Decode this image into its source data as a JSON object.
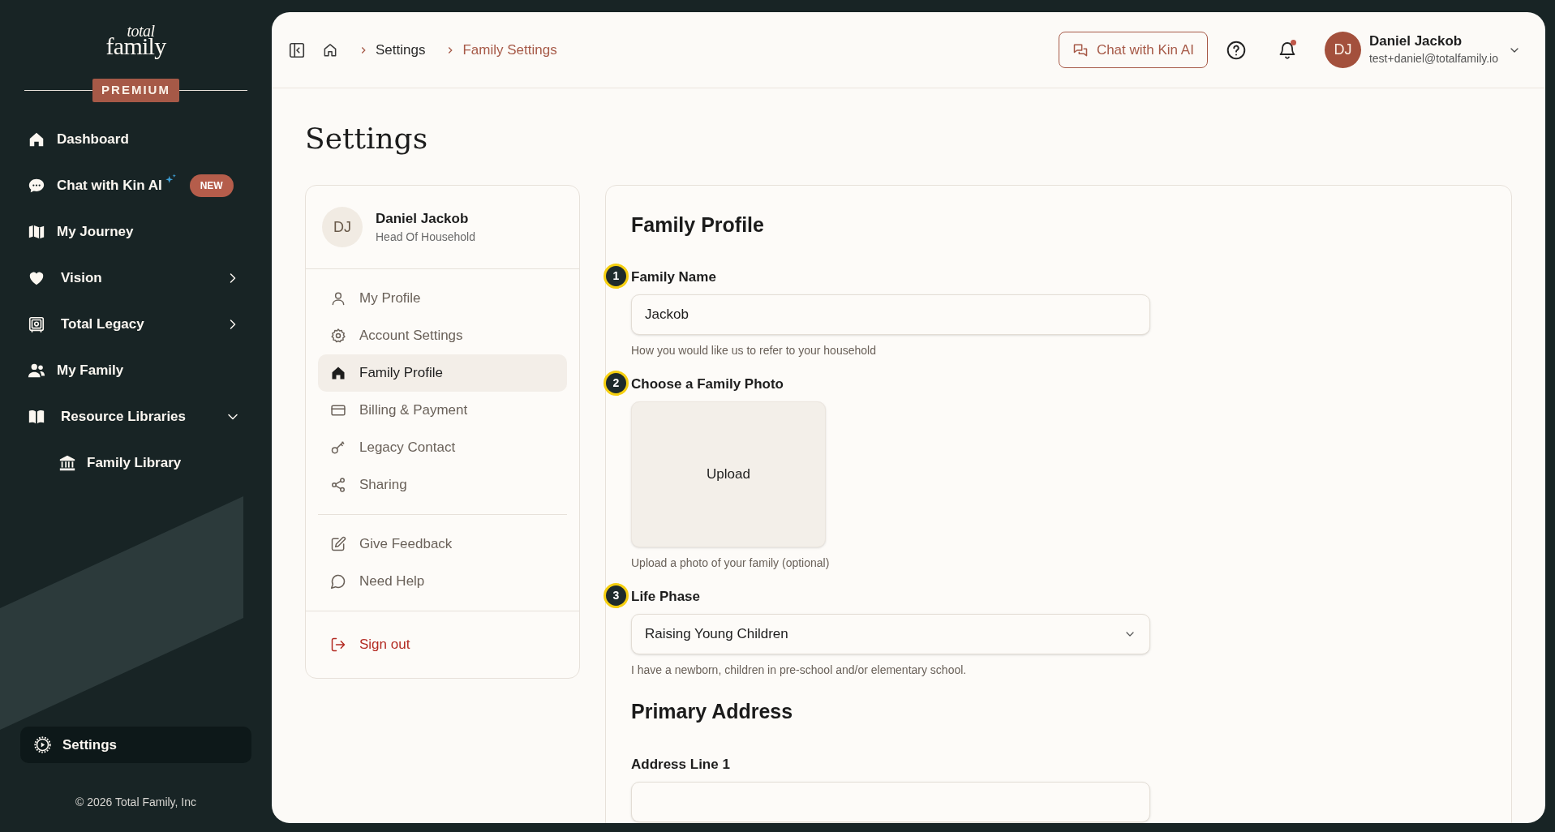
{
  "sidebar": {
    "logo_top": "total",
    "logo_bottom": "family",
    "plan_badge": "PREMIUM",
    "items": [
      {
        "label": "Dashboard",
        "selected": false
      },
      {
        "label": "Chat with Kin AI",
        "badge": "NEW",
        "sparkle": true,
        "selected": false
      },
      {
        "label": "My Journey",
        "selected": false
      },
      {
        "label": "Vision",
        "expanded": false,
        "selected": false
      },
      {
        "label": "Total Legacy",
        "expanded": false,
        "selected": false
      },
      {
        "label": "My Family",
        "selected": false
      },
      {
        "label": "Resource Libraries",
        "expanded": true,
        "selected": false,
        "children": [
          {
            "label": "Family Library",
            "selected": false
          }
        ]
      }
    ],
    "settings_button": {
      "label": "Settings",
      "selected": true
    },
    "copyright": "© 2026 Total Family, Inc"
  },
  "header": {
    "breadcrumbs": [
      {
        "label": "Settings",
        "current": false
      },
      {
        "label": "Family Settings",
        "current": true
      }
    ],
    "chat_button": "Chat with Kin AI",
    "notification_dot": true,
    "user": {
      "initials": "DJ",
      "name": "Daniel Jackob",
      "email": "test+daniel@totalfamily.io"
    }
  },
  "page_title": "Settings",
  "settings_nav": {
    "user": {
      "initials": "DJ",
      "name": "Daniel Jackob",
      "role": "Head Of Household"
    },
    "groups": [
      [
        {
          "label": "My Profile",
          "selected": false
        },
        {
          "label": "Account Settings",
          "selected": false
        },
        {
          "label": "Family Profile",
          "selected": true
        },
        {
          "label": "Billing & Payment",
          "selected": false
        },
        {
          "label": "Legacy Contact",
          "selected": false
        },
        {
          "label": "Sharing",
          "selected": false
        }
      ],
      [
        {
          "label": "Give Feedback",
          "selected": false
        },
        {
          "label": "Need Help",
          "selected": false
        }
      ],
      [
        {
          "label": "Sign out",
          "selected": false,
          "danger": true
        }
      ]
    ]
  },
  "form": {
    "sections": [
      {
        "title": "Family Profile",
        "fields": [
          {
            "kind": "text",
            "marker": "1",
            "label": "Family Name",
            "value": "Jackob",
            "hint": "How you would like us to refer to your household"
          },
          {
            "kind": "upload",
            "marker": "2",
            "label": "Choose a Family Photo",
            "button": "Upload",
            "hint": "Upload a photo of your family (optional)"
          },
          {
            "kind": "select",
            "marker": "3",
            "label": "Life Phase",
            "value": "Raising Young Children",
            "hint": "I have a newborn, children in pre-school and/or elementary school."
          }
        ]
      },
      {
        "title": "Primary Address",
        "fields": [
          {
            "kind": "text",
            "label": "Address Line 1"
          }
        ]
      }
    ]
  }
}
